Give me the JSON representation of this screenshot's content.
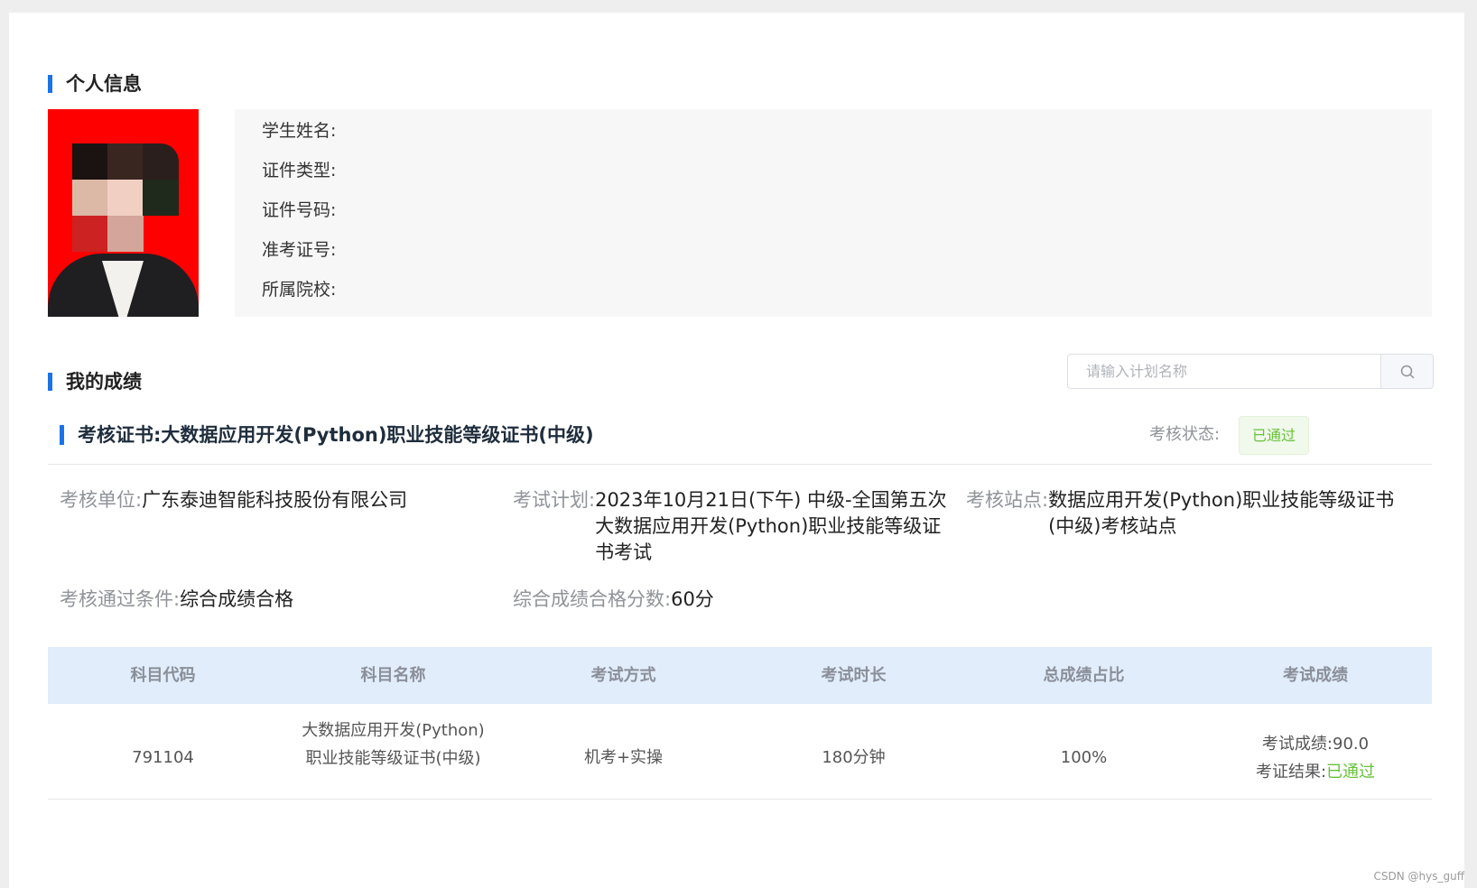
{
  "personal_info": {
    "section_title": "个人信息",
    "fields": [
      "学生姓名:",
      "证件类型:",
      "证件号码:",
      "准考证号:",
      "所属院校:"
    ]
  },
  "grades": {
    "section_title": "我的成绩",
    "search_placeholder": "请输入计划名称",
    "cert_title": "考核证书:大数据应用开发(Python)职业技能等级证书(中级)",
    "status_label": "考核状态:",
    "status_value": "已通过",
    "status_color": "#67c23a",
    "details": {
      "unit_label": "考核单位:",
      "unit_value": "广东泰迪智能科技股份有限公司",
      "plan_label": "考试计划:",
      "plan_value": "2023年10月21日(下午) 中级-全国第五次大数据应用开发(Python)职业技能等级证书考试",
      "site_label": "考核站点:",
      "site_value": "数据应用开发(Python)职业技能等级证书(中级)考核站点",
      "pass_cond_label": "考核通过条件:",
      "pass_cond_value": "综合成绩合格",
      "pass_score_label": "综合成绩合格分数:",
      "pass_score_value": "60分"
    },
    "table": {
      "headers": [
        "科目代码",
        "科目名称",
        "考试方式",
        "考试时长",
        "总成绩占比",
        "考试成绩"
      ],
      "rows": [
        {
          "code": "791104",
          "name": "大数据应用开发(Python)职业技能等级证书(中级)",
          "method": "机考+实操",
          "duration": "180分钟",
          "ratio": "100%",
          "score_label": "考试成绩:",
          "score_value": "90.0",
          "result_label": "考证结果:",
          "result_value": "已通过"
        }
      ]
    }
  },
  "watermark": "CSDN @hys_guff",
  "accent_color": "#1a73e8"
}
